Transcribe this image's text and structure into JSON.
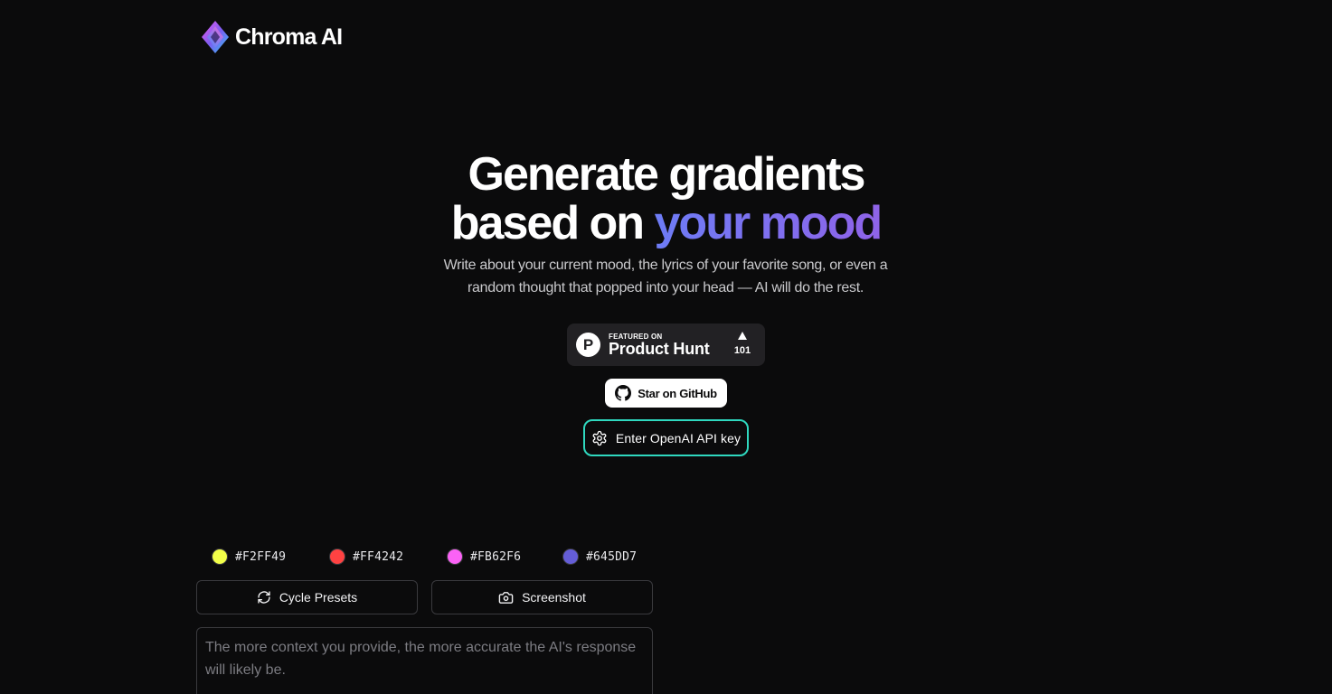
{
  "brand": {
    "name": "Chroma AI",
    "logo_icon": "diamond-gradient-icon"
  },
  "hero": {
    "title_line1": "Generate gradients",
    "title_line2_prefix": "based on ",
    "title_line2_accent": "your mood",
    "subtitle": "Write about your current mood, the lyrics of your favorite song, or even a random thought that popped into your head — AI will do the rest.",
    "accent_colors": [
      "#6d7cf6",
      "#8f63e8"
    ]
  },
  "product_hunt": {
    "logo_letter": "P",
    "featured_label": "FEATURED ON",
    "name": "Product Hunt",
    "upvotes": "101"
  },
  "github": {
    "label": "Star on GitHub",
    "icon": "github-icon"
  },
  "api_key": {
    "label": "Enter OpenAI API key",
    "icon": "gear-icon",
    "border_color": "#2fd8bf"
  },
  "colors": [
    {
      "hex": "#F2FF49",
      "label": "#F2FF49"
    },
    {
      "hex": "#FF4242",
      "label": "#FF4242"
    },
    {
      "hex": "#FB62F6",
      "label": "#FB62F6"
    },
    {
      "hex": "#645DD7",
      "label": "#645DD7"
    }
  ],
  "actions": {
    "cycle_label": "Cycle Presets",
    "screenshot_label": "Screenshot"
  },
  "mood_input": {
    "value": "",
    "placeholder": "The more context you provide, the more accurate the AI's response will likely be."
  }
}
